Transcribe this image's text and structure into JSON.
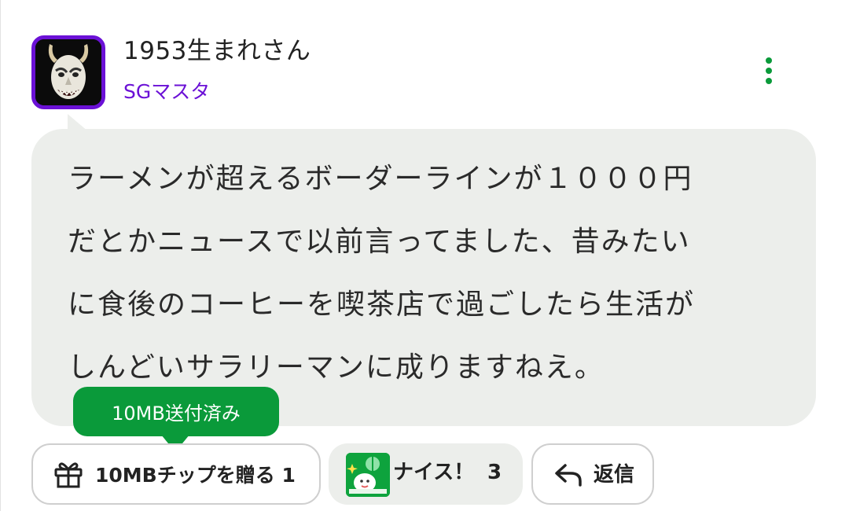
{
  "comment": {
    "author": {
      "name": "1953生まれさん",
      "rank": "SGマスタ",
      "avatar_icon": "hannya-mask-avatar"
    },
    "text": "ラーメンが超えるボーダーラインが１０００円\nだとかニュースで以前言ってました、昔みたい\nに食後のコーヒーを喫茶店で過ごしたら生活が\nしんどいサラリーマンに成りますねえ。",
    "tip_status": "10MB送付済み"
  },
  "actions": {
    "tip": {
      "label": "10MBチップを贈る",
      "count": "1",
      "icon": "gift-icon"
    },
    "nice": {
      "label": "ナイス！",
      "count": "3",
      "icon": "nice-sticker-icon"
    },
    "reply": {
      "label": "返信",
      "icon": "reply-arrow-icon"
    },
    "more_icon": "more-vertical-icon"
  },
  "colors": {
    "accent_purple": "#6b11d6",
    "accent_green": "#0a9a3a",
    "bubble_bg": "#eceeeb",
    "text": "#2a2a2a"
  }
}
